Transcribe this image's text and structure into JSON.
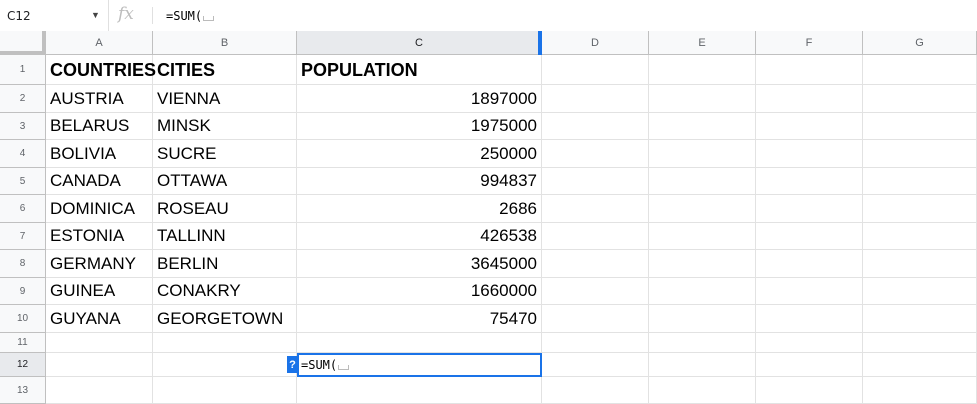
{
  "formula_bar": {
    "cell_ref": "C12",
    "fx_icon": "fx-icon",
    "formula": "=SUM("
  },
  "columns": [
    "A",
    "B",
    "C",
    "D",
    "E",
    "F",
    "G"
  ],
  "selected_column": "C",
  "rows": [
    "1",
    "2",
    "3",
    "4",
    "5",
    "6",
    "7",
    "8",
    "9",
    "10",
    "11",
    "12",
    "13"
  ],
  "selected_row": "12",
  "table": {
    "headers": [
      "COUNTRIES",
      "CITIES",
      "POPULATION"
    ],
    "data": [
      [
        "AUSTRIA",
        "VIENNA",
        "1897000"
      ],
      [
        "BELARUS",
        "MINSK",
        "1975000"
      ],
      [
        "BOLIVIA",
        "SUCRE",
        "250000"
      ],
      [
        "CANADA",
        "OTTAWA",
        "994837"
      ],
      [
        "DOMINICA",
        "ROSEAU",
        "2686"
      ],
      [
        "ESTONIA",
        "TALLINN",
        "426538"
      ],
      [
        "GERMANY",
        "BERLIN",
        "3645000"
      ],
      [
        "GUINEA",
        "CONAKRY",
        "1660000"
      ],
      [
        "GUYANA",
        "GEORGETOWN",
        "75470"
      ]
    ]
  },
  "active_cell": {
    "ref": "C12",
    "value": "=SUM(",
    "help_badge": "?"
  },
  "colors": {
    "accent": "#1a73e8"
  }
}
